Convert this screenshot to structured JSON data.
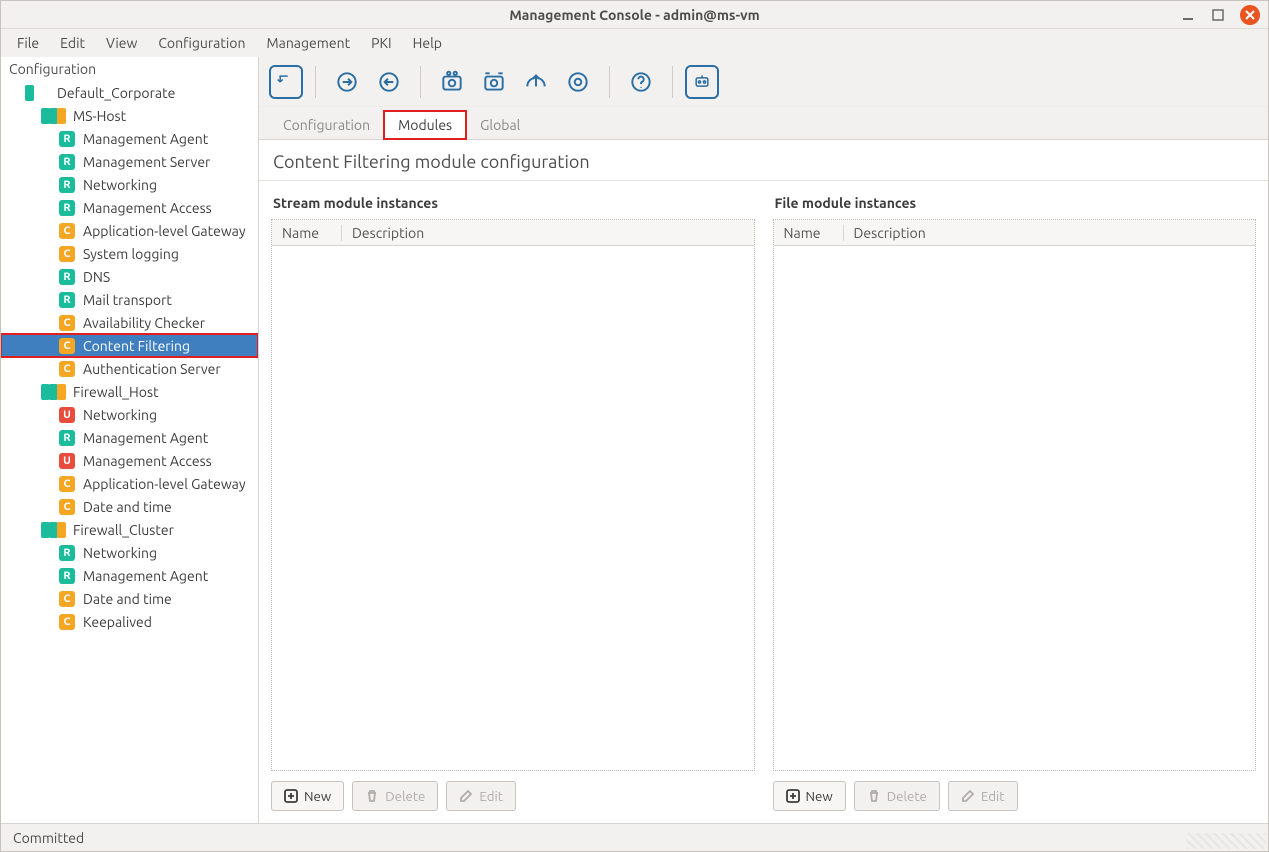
{
  "window": {
    "title": "Management Console - admin@ms-vm"
  },
  "menu": {
    "items": [
      "File",
      "Edit",
      "View",
      "Configuration",
      "Management",
      "PKI",
      "Help"
    ]
  },
  "sidebar": {
    "title": "Configuration",
    "tree": [
      {
        "type": "site",
        "label": "Default_Corporate",
        "dots": [
          "g"
        ]
      },
      {
        "type": "host",
        "label": "MS-Host",
        "dots": [
          "g",
          "g",
          "y"
        ]
      },
      {
        "type": "leaf",
        "badge": "R",
        "label": "Management Agent"
      },
      {
        "type": "leaf",
        "badge": "R",
        "label": "Management Server"
      },
      {
        "type": "leaf",
        "badge": "R",
        "label": "Networking"
      },
      {
        "type": "leaf",
        "badge": "R",
        "label": "Management Access"
      },
      {
        "type": "leaf",
        "badge": "C",
        "label": "Application-level Gateway"
      },
      {
        "type": "leaf",
        "badge": "C",
        "label": "System logging"
      },
      {
        "type": "leaf",
        "badge": "R",
        "label": "DNS"
      },
      {
        "type": "leaf",
        "badge": "R",
        "label": "Mail transport"
      },
      {
        "type": "leaf",
        "badge": "C",
        "label": "Availability Checker"
      },
      {
        "type": "leaf",
        "badge": "C",
        "label": "Content Filtering",
        "selected": true
      },
      {
        "type": "leaf",
        "badge": "C",
        "label": "Authentication Server"
      },
      {
        "type": "host",
        "label": "Firewall_Host",
        "dots": [
          "g",
          "g",
          "y"
        ]
      },
      {
        "type": "leaf",
        "badge": "U",
        "label": "Networking"
      },
      {
        "type": "leaf",
        "badge": "R",
        "label": "Management Agent"
      },
      {
        "type": "leaf",
        "badge": "U",
        "label": "Management Access"
      },
      {
        "type": "leaf",
        "badge": "C",
        "label": "Application-level Gateway"
      },
      {
        "type": "leaf",
        "badge": "C",
        "label": "Date and time"
      },
      {
        "type": "host",
        "label": "Firewall_Cluster",
        "dots": [
          "g",
          "g",
          "y"
        ]
      },
      {
        "type": "leaf",
        "badge": "R",
        "label": "Networking"
      },
      {
        "type": "leaf",
        "badge": "R",
        "label": "Management Agent"
      },
      {
        "type": "leaf",
        "badge": "C",
        "label": "Date and time"
      },
      {
        "type": "leaf",
        "badge": "C",
        "label": "Keepalived"
      }
    ]
  },
  "toolbar": {
    "icons": [
      "commit-icon",
      "refresh-in-icon",
      "refresh-out-icon",
      "services-icon",
      "deploy-icon",
      "upload-icon",
      "settings-icon",
      "help-icon",
      "robot-icon"
    ]
  },
  "tabs": {
    "items": [
      "Configuration",
      "Modules",
      "Global"
    ],
    "active": "Modules"
  },
  "page": {
    "title": "Content Filtering module configuration"
  },
  "panels": {
    "stream": {
      "title": "Stream module instances",
      "columns": [
        "Name",
        "Description"
      ],
      "rows": []
    },
    "file": {
      "title": "File module instances",
      "columns": [
        "Name",
        "Description"
      ],
      "rows": []
    },
    "buttons": {
      "new_": "New",
      "delete_": "Delete",
      "edit_": "Edit"
    }
  },
  "status": {
    "text": "Committed"
  }
}
